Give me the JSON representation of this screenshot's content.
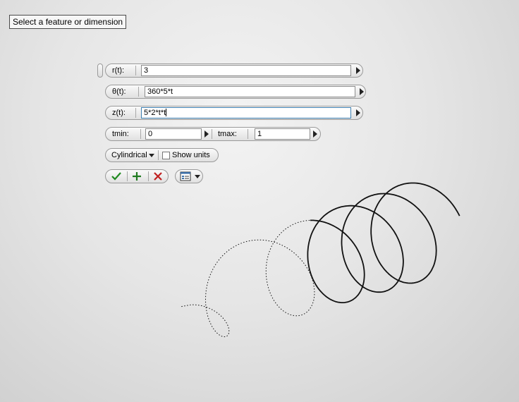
{
  "status": {
    "prompt": "Select a feature or dimension"
  },
  "equations": {
    "r": {
      "label": "r(t):",
      "value": "3"
    },
    "theta": {
      "label": "θ(t):",
      "value": "360*5*t"
    },
    "z": {
      "label": "z(t):",
      "value": "5*2*t*t"
    }
  },
  "range": {
    "tmin_label": "tmin:",
    "tmin_value": "0",
    "tmax_label": "tmax:",
    "tmax_value": "1"
  },
  "options": {
    "coordinate_system": "Cylindrical",
    "show_units_label": "Show units",
    "show_units_checked": false
  },
  "actions": {
    "ok_icon": "checkmark-icon",
    "apply_icon": "plus-icon",
    "cancel_icon": "x-icon",
    "options_icon": "dialog-options-icon"
  },
  "colors": {
    "ok": "#1f8a1f",
    "apply": "#1f7a1f",
    "cancel": "#c02020",
    "field_focus": "#3c7fb1",
    "curve": "#111111"
  }
}
